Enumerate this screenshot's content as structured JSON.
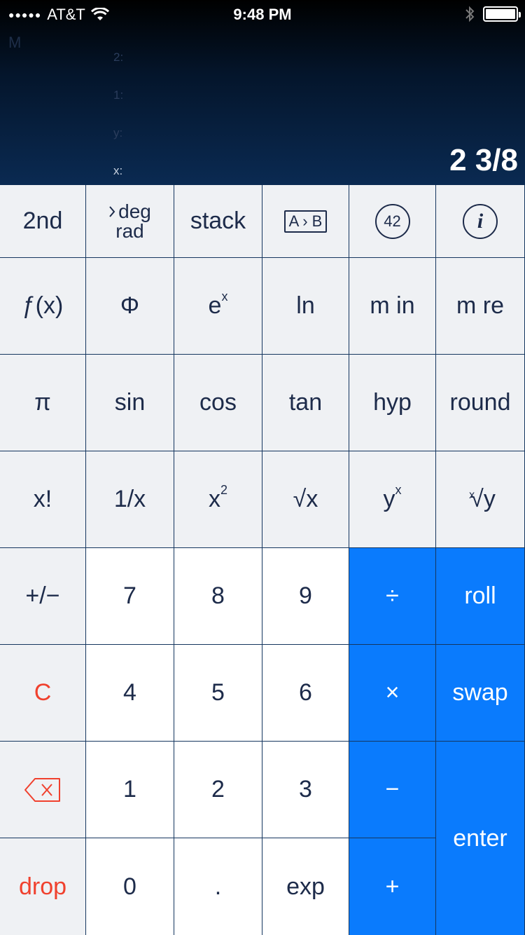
{
  "status_bar": {
    "signal_dots": "●●●●●",
    "carrier": "AT&T",
    "time": "9:48 PM"
  },
  "display": {
    "memory_indicator": "M",
    "stack_labels": [
      "2:",
      "1:",
      "y:",
      "x:"
    ],
    "result": "2 3/8"
  },
  "keys": {
    "second": "2nd",
    "deg": "deg",
    "rad": "rad",
    "stack": "stack",
    "a_to_b": "A › B",
    "constant": "42",
    "info": "i",
    "fx": "ƒ(x)",
    "phi": "Φ",
    "ex_base": "e",
    "ex_exp": "x",
    "ln": "ln",
    "m_in": "m in",
    "m_re": "m re",
    "pi": "π",
    "sin": "sin",
    "cos": "cos",
    "tan": "tan",
    "hyp": "hyp",
    "round": "round",
    "factorial": "x!",
    "reciprocal": "1/x",
    "square_base": "x",
    "square_exp": "2",
    "sqrt": "√x",
    "yx_base": "y",
    "yx_exp": "x",
    "root_index": "x",
    "root_radicand": "√y",
    "plus_minus": "+/−",
    "seven": "7",
    "eight": "8",
    "nine": "9",
    "divide": "÷",
    "roll": "roll",
    "clear": "C",
    "four": "4",
    "five": "5",
    "six": "6",
    "multiply": "×",
    "swap": "swap",
    "one": "1",
    "two": "2",
    "three": "3",
    "minus": "−",
    "enter": "enter",
    "drop": "drop",
    "zero": "0",
    "decimal": ".",
    "exp": "exp",
    "plus": "+"
  },
  "colors": {
    "accent_blue": "#0a7bfd",
    "destructive_red": "#f0412e",
    "key_text": "#1d2b4a",
    "function_key_bg": "#eff1f4"
  },
  "icons": {
    "wifi": "wifi-icon",
    "bluetooth": "bluetooth-icon",
    "battery": "battery-icon",
    "backspace": "backspace-icon",
    "mode_chevron": "chevron-right-icon"
  }
}
